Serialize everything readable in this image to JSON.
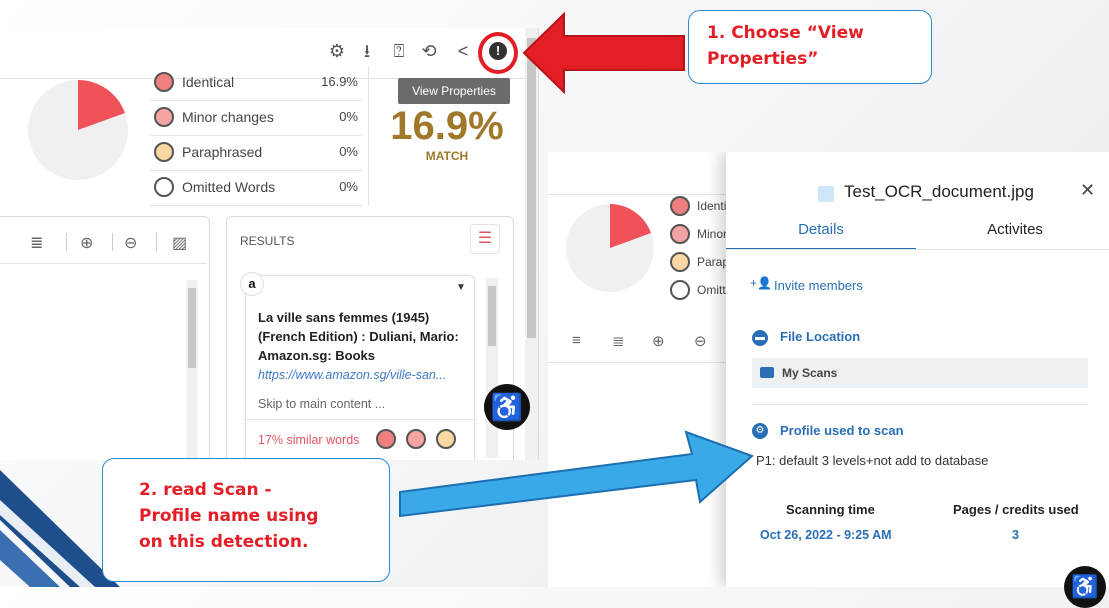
{
  "callouts": {
    "step1": [
      "1. Choose “View",
      "Properties”"
    ],
    "step2": [
      "2. read Scan -",
      "Profile name using",
      "on this detection."
    ]
  },
  "left": {
    "toolbar": {
      "settings_icon": "gear-icon",
      "download_icon": "download-icon",
      "help_icon": "help-icon",
      "rescan_icon": "rescan-icon",
      "share_icon": "share-icon",
      "properties_icon": "info-icon"
    },
    "tooltip": "View Properties",
    "legend": [
      {
        "label": "Identical",
        "pct": "16.9%",
        "color": "#f08080"
      },
      {
        "label": "Minor changes",
        "pct": "0%",
        "color": "#f5a3a3"
      },
      {
        "label": "Paraphrased",
        "pct": "0%",
        "color": "#fcd7a4"
      },
      {
        "label": "Omitted Words",
        "pct": "0%",
        "color": "#ffffff"
      }
    ],
    "match_value": "16.9%",
    "match_label": "MATCH",
    "results_label": "RESULTS",
    "result_card": {
      "source_icon": "amazon-icon",
      "title": "La ville sans femmes (1945) (French Edition) : Duliani, Mario: Amazon.sg: Books",
      "url": "https://www.amazon.sg/ville-san...",
      "snippet": "Skip to main content ...",
      "similar": "17% similar words"
    }
  },
  "right": {
    "legend_partial": [
      "Identi",
      "Minor",
      "Parap",
      "Omitt"
    ],
    "drawer": {
      "file_name": "Test_OCR_document.jpg",
      "tabs": [
        "Details",
        "Activites"
      ],
      "active_tab": "Details",
      "invite": "Invite members",
      "file_location_title": "File Location",
      "file_location_value": "My Scans",
      "profile_title": "Profile used to scan",
      "profile_value": "P1: default 3 levels+not add to database",
      "scanning_time_label": "Scanning time",
      "scanning_time_value": "Oct 26, 2022 - 9:25 AM",
      "pages_label": "Pages / credits used",
      "pages_value": "3"
    }
  },
  "colors": {
    "accent_blue": "#2a6fb6",
    "callout_red": "#e41e26",
    "match_gold": "#a0782a",
    "arrow_blue": "#39a9e8"
  }
}
